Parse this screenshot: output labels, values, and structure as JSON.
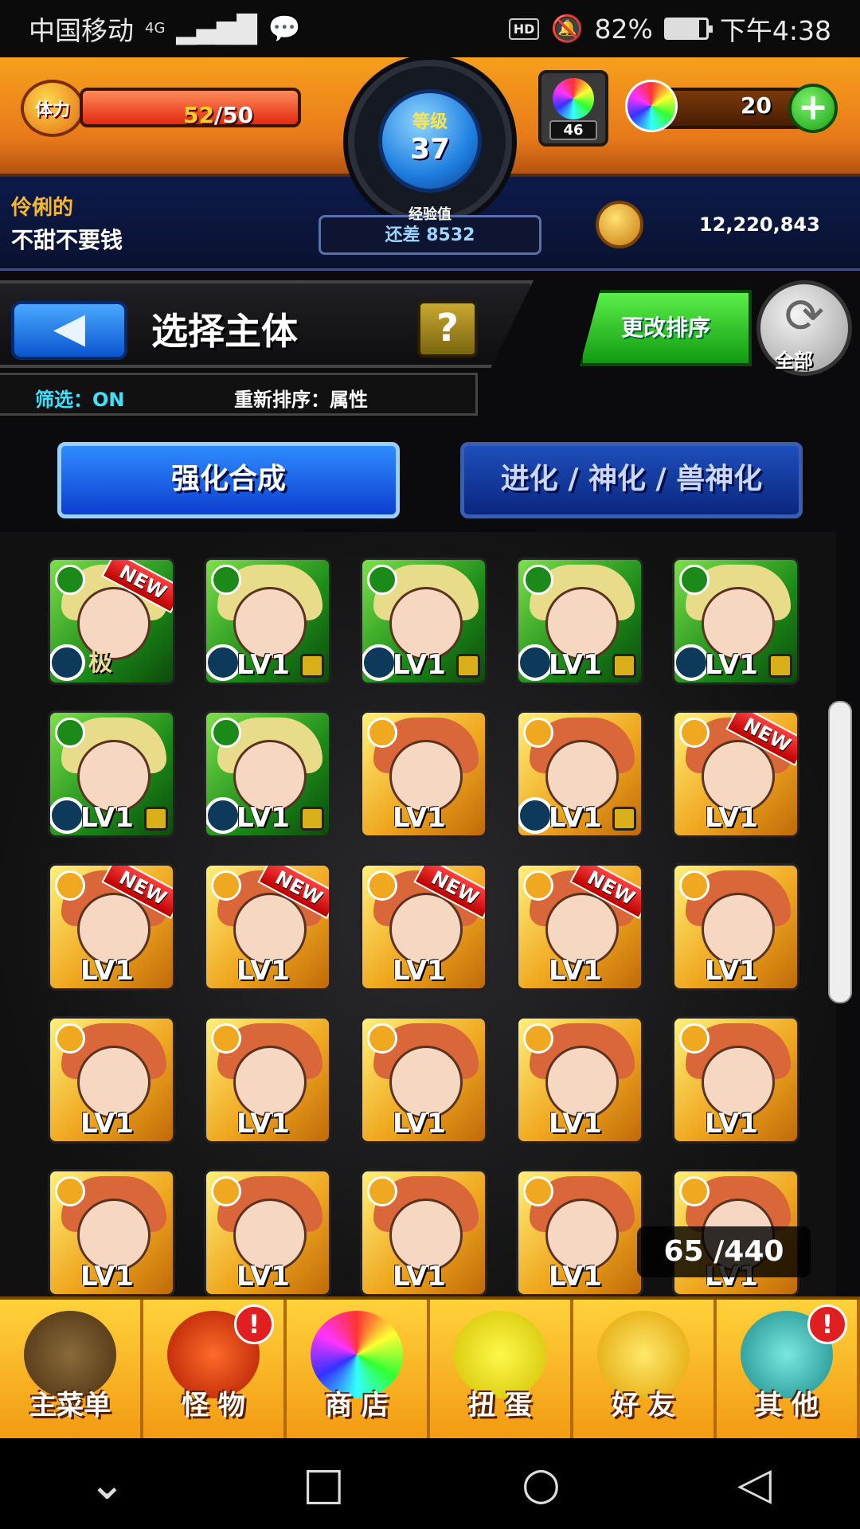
{
  "status_bar": {
    "carrier": "中国移动",
    "network": "4G",
    "hd": "HD",
    "battery": "82%",
    "time": "下午4:38"
  },
  "header": {
    "stamina_label": "体力",
    "stamina_current": "52",
    "stamina_max": "/50",
    "level_label": "等级",
    "level": "37",
    "exp_label": "经验值",
    "exp_remaining": "还差 8532",
    "orb_stock": "46",
    "gem_count": "20",
    "user_title": "伶俐的",
    "user_name": "不甜不要钱",
    "coins": "12,220,843"
  },
  "screen": {
    "title": "选择主体",
    "help": "?",
    "filter": "筛选：ON",
    "sort": "重新排序：属性",
    "change_sort": "更改排序",
    "refresh_label": "全部"
  },
  "tabs": [
    "强化合成",
    "进化 / 神化 / 兽神化"
  ],
  "grid": {
    "count": "65 /440",
    "level_text": "LV1",
    "new_text": "NEW",
    "ex_text": "极",
    "rows": [
      [
        {
          "attr": "wood",
          "new": true,
          "ex": true,
          "lock": false
        },
        {
          "attr": "wood",
          "new": false,
          "lock": true
        },
        {
          "attr": "wood",
          "new": false,
          "lock": true
        },
        {
          "attr": "wood",
          "new": false,
          "lock": true
        },
        {
          "attr": "wood",
          "new": false,
          "lock": true
        }
      ],
      [
        {
          "attr": "wood",
          "new": false,
          "lock": true
        },
        {
          "attr": "wood",
          "new": false,
          "lock": true
        },
        {
          "attr": "light",
          "new": false,
          "lock": false
        },
        {
          "attr": "light",
          "new": false,
          "lock": true
        },
        {
          "attr": "light",
          "new": true,
          "lock": false
        }
      ],
      [
        {
          "attr": "light",
          "new": true,
          "lock": false
        },
        {
          "attr": "light",
          "new": true,
          "lock": false
        },
        {
          "attr": "light",
          "new": true,
          "lock": false
        },
        {
          "attr": "light",
          "new": true,
          "lock": false
        },
        {
          "attr": "light",
          "new": false,
          "lock": false
        }
      ],
      [
        {
          "attr": "light",
          "new": false,
          "lock": false
        },
        {
          "attr": "light",
          "new": false,
          "lock": false
        },
        {
          "attr": "light",
          "new": false,
          "lock": false
        },
        {
          "attr": "light",
          "new": false,
          "lock": false
        },
        {
          "attr": "light",
          "new": false,
          "lock": false
        }
      ],
      [
        {
          "attr": "light",
          "new": false,
          "lock": false
        },
        {
          "attr": "light",
          "new": false,
          "lock": false
        },
        {
          "attr": "light",
          "new": false,
          "lock": false
        },
        {
          "attr": "light",
          "new": false,
          "lock": false
        },
        {
          "attr": "light",
          "new": false,
          "lock": false
        }
      ]
    ]
  },
  "bottom_nav": [
    {
      "label": "主菜单",
      "icon": "castle-gate-icon",
      "alert": false
    },
    {
      "label": "怪 物",
      "icon": "dragon-icon",
      "alert": true
    },
    {
      "label": "商 店",
      "icon": "rainbow-orb-icon",
      "alert": false
    },
    {
      "label": "扭 蛋",
      "icon": "egg-icon",
      "alert": false
    },
    {
      "label": "好 友",
      "icon": "friends-icon",
      "alert": false
    },
    {
      "label": "其 他",
      "icon": "question-mark-icon",
      "alert": true
    }
  ],
  "alert_mark": "!",
  "colors": {
    "header_orange": "#f39a12",
    "info_navy": "#0d1a4a",
    "tab_blue": "#2f8cff",
    "sort_green": "#5bf04a",
    "wood": "#1b8a18",
    "light": "#f0a820"
  }
}
